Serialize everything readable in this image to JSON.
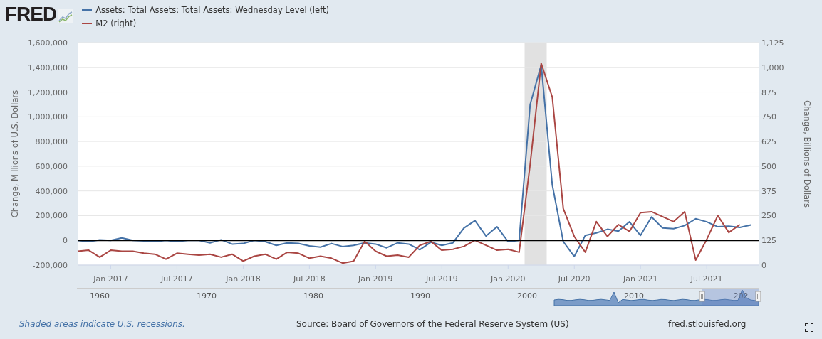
{
  "logo": {
    "text": "FRED"
  },
  "chart": {
    "chart_data": {
      "type": "line",
      "ylabel": "Change, Millions of U.S. Dollars",
      "y2label": "Change, Billions of Dollars",
      "categories": [
        null,
        null,
        null,
        "Jan 2017",
        null,
        null,
        null,
        null,
        null,
        "Jul 2017",
        null,
        null,
        null,
        null,
        null,
        "Jan 2018",
        null,
        null,
        null,
        null,
        null,
        "Jul 2018",
        null,
        null,
        null,
        null,
        null,
        "Jan 2019",
        null,
        null,
        null,
        null,
        null,
        "Jul 2019",
        null,
        null,
        null,
        null,
        null,
        "Jan 2020",
        null,
        null,
        null,
        null,
        null,
        "Jul 2020",
        null,
        null,
        null,
        null,
        null,
        "Jan 2021",
        null,
        null,
        null,
        null,
        null,
        "Jul 2021",
        null,
        null,
        null,
        null
      ],
      "ylim": [
        -200000,
        1600000
      ],
      "yticks": [
        {
          "value": -200000,
          "label": "-200,000"
        },
        {
          "value": 0,
          "label": "0"
        },
        {
          "value": 200000,
          "label": "200,000"
        },
        {
          "value": 400000,
          "label": "400,000"
        },
        {
          "value": 600000,
          "label": "600,000"
        },
        {
          "value": 800000,
          "label": "800,000"
        },
        {
          "value": 1000000,
          "label": "1,000,000"
        },
        {
          "value": 1200000,
          "label": "1,200,000"
        },
        {
          "value": 1400000,
          "label": "1,400,000"
        },
        {
          "value": 1600000,
          "label": "1,600,000"
        }
      ],
      "y2lim": [
        0,
        1125
      ],
      "y2ticks": [
        {
          "value": 0,
          "label": "0"
        },
        {
          "value": 125,
          "label": "125"
        },
        {
          "value": 250,
          "label": "250"
        },
        {
          "value": 375,
          "label": "375"
        },
        {
          "value": 500,
          "label": "500"
        },
        {
          "value": 625,
          "label": "625"
        },
        {
          "value": 750,
          "label": "750"
        },
        {
          "value": 875,
          "label": "875"
        },
        {
          "value": 1000,
          "label": "1,000"
        },
        {
          "value": 1125,
          "label": "1,125"
        }
      ],
      "series": [
        {
          "name": "Assets: Total Assets: Total Assets: Wednesday Level (left)",
          "color": "#4572a7",
          "values": [
            0,
            -10000,
            5000,
            0,
            20000,
            0,
            -5000,
            -10000,
            0,
            -10000,
            0,
            0,
            -20000,
            5000,
            -30000,
            -25000,
            0,
            -10000,
            -40000,
            -20000,
            -25000,
            -45000,
            -55000,
            -25000,
            -50000,
            -40000,
            -20000,
            -30000,
            -60000,
            -20000,
            -30000,
            -75000,
            -15000,
            -40000,
            -20000,
            100000,
            160000,
            35000,
            110000,
            -10000,
            0,
            1100000,
            1420000,
            450000,
            -10000,
            -130000,
            40000,
            60000,
            90000,
            75000,
            150000,
            40000,
            190000,
            100000,
            95000,
            120000,
            175000,
            150000,
            110000,
            115000,
            105000,
            125000
          ]
        },
        {
          "name": "M2 (right)",
          "color": "#aa4643",
          "axis": "y2",
          "values": [
            70,
            75,
            40,
            75,
            70,
            70,
            60,
            55,
            30,
            60,
            55,
            50,
            55,
            40,
            55,
            20,
            45,
            55,
            30,
            65,
            60,
            35,
            45,
            35,
            10,
            20,
            120,
            70,
            45,
            50,
            40,
            100,
            120,
            75,
            80,
            95,
            125,
            100,
            75,
            80,
            65,
            510,
            1020,
            850,
            285,
            145,
            65,
            220,
            145,
            205,
            170,
            265,
            270,
            245,
            220,
            270,
            25,
            130,
            250,
            165,
            205,
            null
          ]
        }
      ],
      "grid": true
    },
    "recession_band": {
      "shown": true
    }
  },
  "navigator": {
    "labels": [
      "1960",
      "1970",
      "1980",
      "1990",
      "2000",
      "2010",
      "202"
    ]
  },
  "footer": {
    "note": "Shaded areas indicate U.S. recessions.",
    "source": "Source: Board of Governors of the Federal Reserve System (US)",
    "site": "fred.stlouisfed.org"
  }
}
